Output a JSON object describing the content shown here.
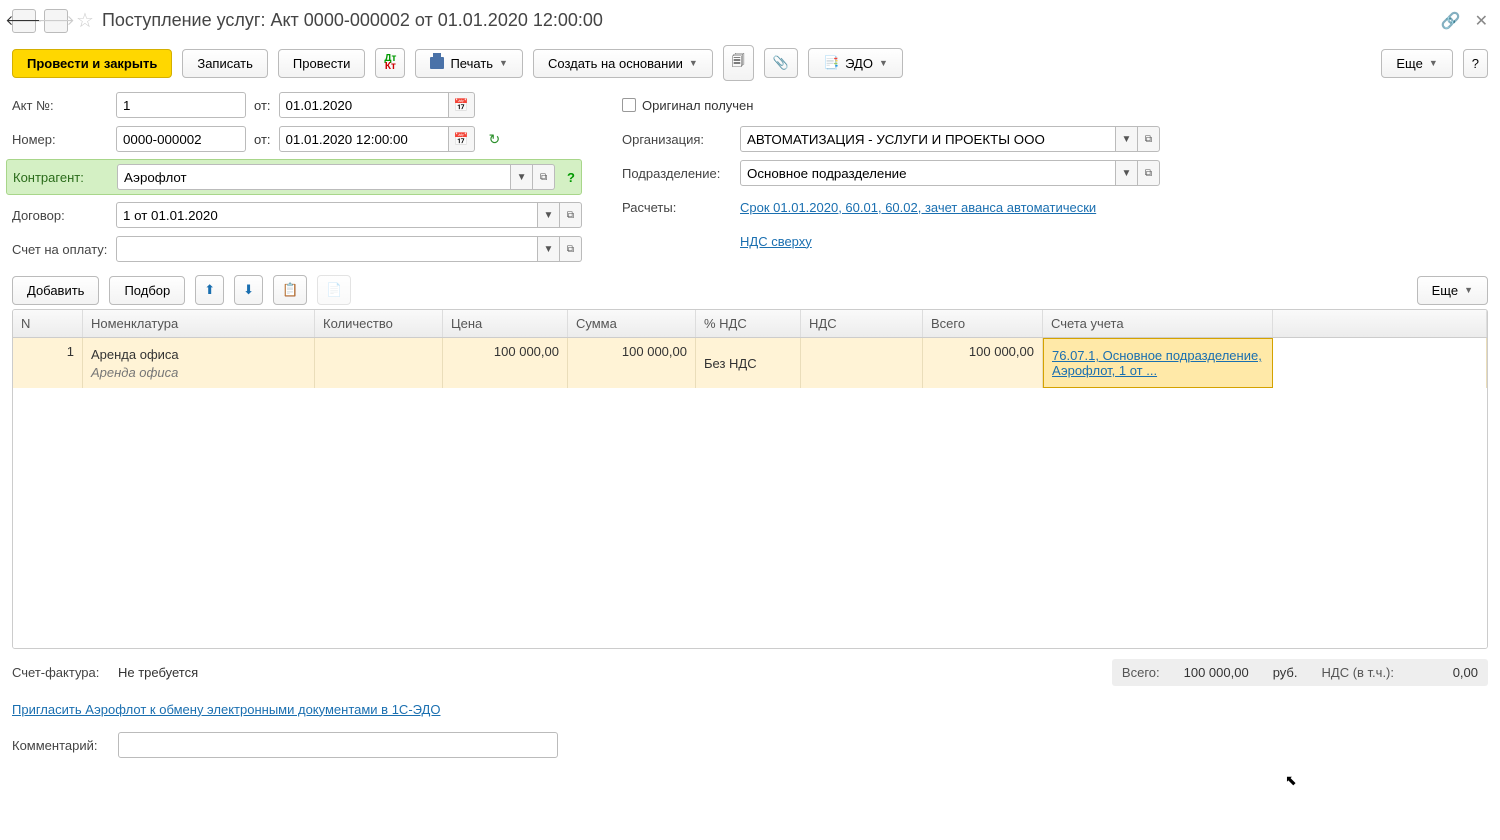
{
  "header": {
    "title": "Поступление услуг: Акт 0000-000002 от 01.01.2020 12:00:00"
  },
  "toolbar": {
    "post_close": "Провести и закрыть",
    "save": "Записать",
    "post": "Провести",
    "print": "Печать",
    "create_based": "Создать на основании",
    "edo": "ЭДО",
    "more": "Еще",
    "help": "?"
  },
  "form": {
    "act_no_label": "Акт №:",
    "act_no": "1",
    "from_label": "от:",
    "act_date": "01.01.2020",
    "number_label": "Номер:",
    "number": "0000-000002",
    "number_date": "01.01.2020 12:00:00",
    "counterparty_label": "Контрагент:",
    "counterparty": "Аэрофлот",
    "contract_label": "Договор:",
    "contract": "1 от 01.01.2020",
    "invoice_label": "Счет на оплату:",
    "invoice": "",
    "original_received": "Оригинал получен",
    "organization_label": "Организация:",
    "organization": "АВТОМАТИЗАЦИЯ - УСЛУГИ И ПРОЕКТЫ ООО",
    "subdivision_label": "Подразделение:",
    "subdivision": "Основное подразделение",
    "settlements_label": "Расчеты:",
    "settlements_link": "Срок 01.01.2020, 60.01, 60.02, зачет аванса автоматически",
    "vat_link": "НДС сверху"
  },
  "table_toolbar": {
    "add": "Добавить",
    "pick": "Подбор",
    "more": "Еще"
  },
  "table": {
    "headers": {
      "n": "N",
      "nomenclature": "Номенклатура",
      "quantity": "Количество",
      "price": "Цена",
      "sum": "Сумма",
      "vat_percent": "% НДС",
      "vat": "НДС",
      "total": "Всего",
      "accounts": "Счета учета"
    },
    "rows": [
      {
        "n": "1",
        "nomenclature": "Аренда офиса",
        "nomenclature_sub": "Аренда офиса",
        "price": "100 000,00",
        "sum": "100 000,00",
        "vat_percent": "Без НДС",
        "total": "100 000,00",
        "accounts": "76.07.1, Основное подразделение, Аэрофлот, 1 от ..."
      }
    ]
  },
  "footer": {
    "invoice_fact_label": "Счет-фактура:",
    "invoice_fact_value": "Не требуется",
    "edo_invite": "Пригласить Аэрофлот к обмену электронными документами в 1С-ЭДО",
    "comment_label": "Комментарий:",
    "comment": "",
    "total_label": "Всего:",
    "total_value": "100 000,00",
    "currency": "руб.",
    "vat_incl_label": "НДС (в т.ч.):",
    "vat_incl_value": "0,00"
  }
}
